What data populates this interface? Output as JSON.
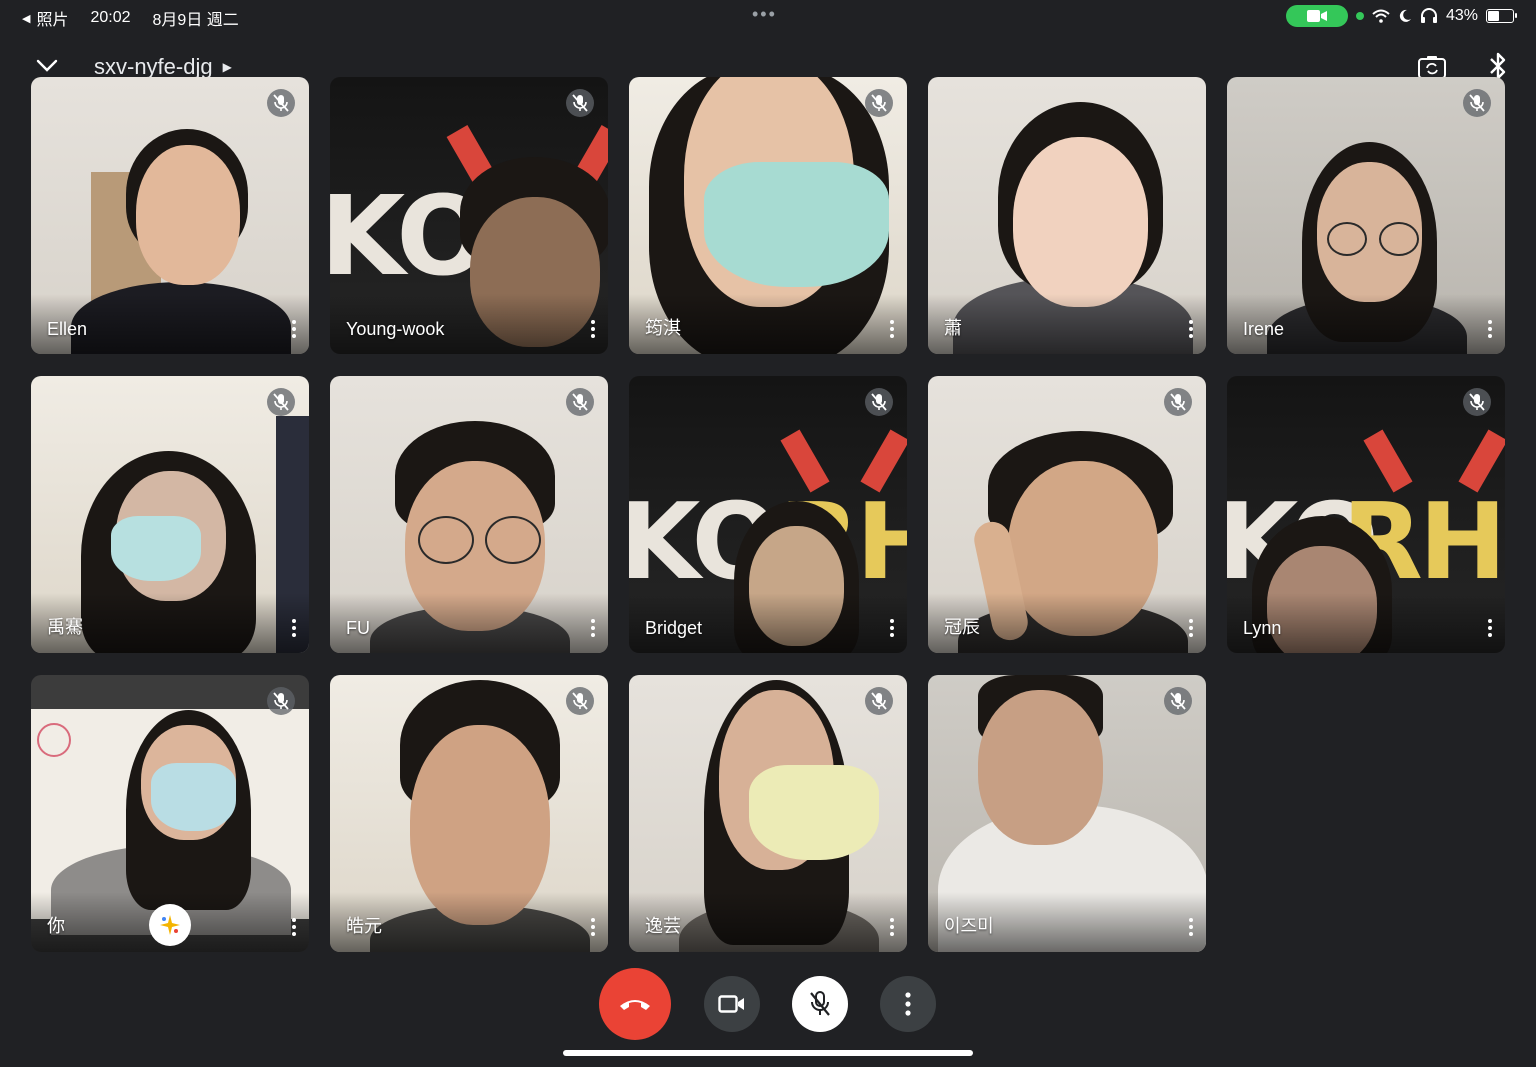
{
  "status_bar": {
    "back_app": "照片",
    "time": "20:02",
    "date": "8月9日 週二",
    "battery": "43%",
    "battery_level": 0.43
  },
  "header": {
    "meeting_code": "sxv-nyfe-djg"
  },
  "participants": [
    {
      "name": "Ellen",
      "muted": true
    },
    {
      "name": "Young-wook",
      "muted": true
    },
    {
      "name": "筠淇",
      "muted": true
    },
    {
      "name": "蕭",
      "muted": false
    },
    {
      "name": "Irene",
      "muted": true
    },
    {
      "name": "禹騫",
      "muted": true
    },
    {
      "name": "FU",
      "muted": true
    },
    {
      "name": "Bridget",
      "muted": true
    },
    {
      "name": "冠辰",
      "muted": true
    },
    {
      "name": "Lynn",
      "muted": true
    },
    {
      "name": "你",
      "muted": true
    },
    {
      "name": "皓元",
      "muted": true
    },
    {
      "name": "逸芸",
      "muted": true
    },
    {
      "name": "이즈미",
      "muted": true
    }
  ],
  "banner": {
    "text_a": "KO",
    "text_b": "RHS"
  },
  "colors": {
    "background": "#202124",
    "end_call": "#ea4335",
    "control": "#3c4043",
    "status_green": "#34c759"
  },
  "icons": {
    "collapse": "chevron-down-icon",
    "switch_camera": "switch-camera-icon",
    "bluetooth": "bluetooth-icon",
    "mic_off": "mic-off-icon",
    "more": "more-vert-icon",
    "end_call": "phone-hangup-icon",
    "camera": "videocam-icon",
    "effects": "sparkle-icon"
  }
}
